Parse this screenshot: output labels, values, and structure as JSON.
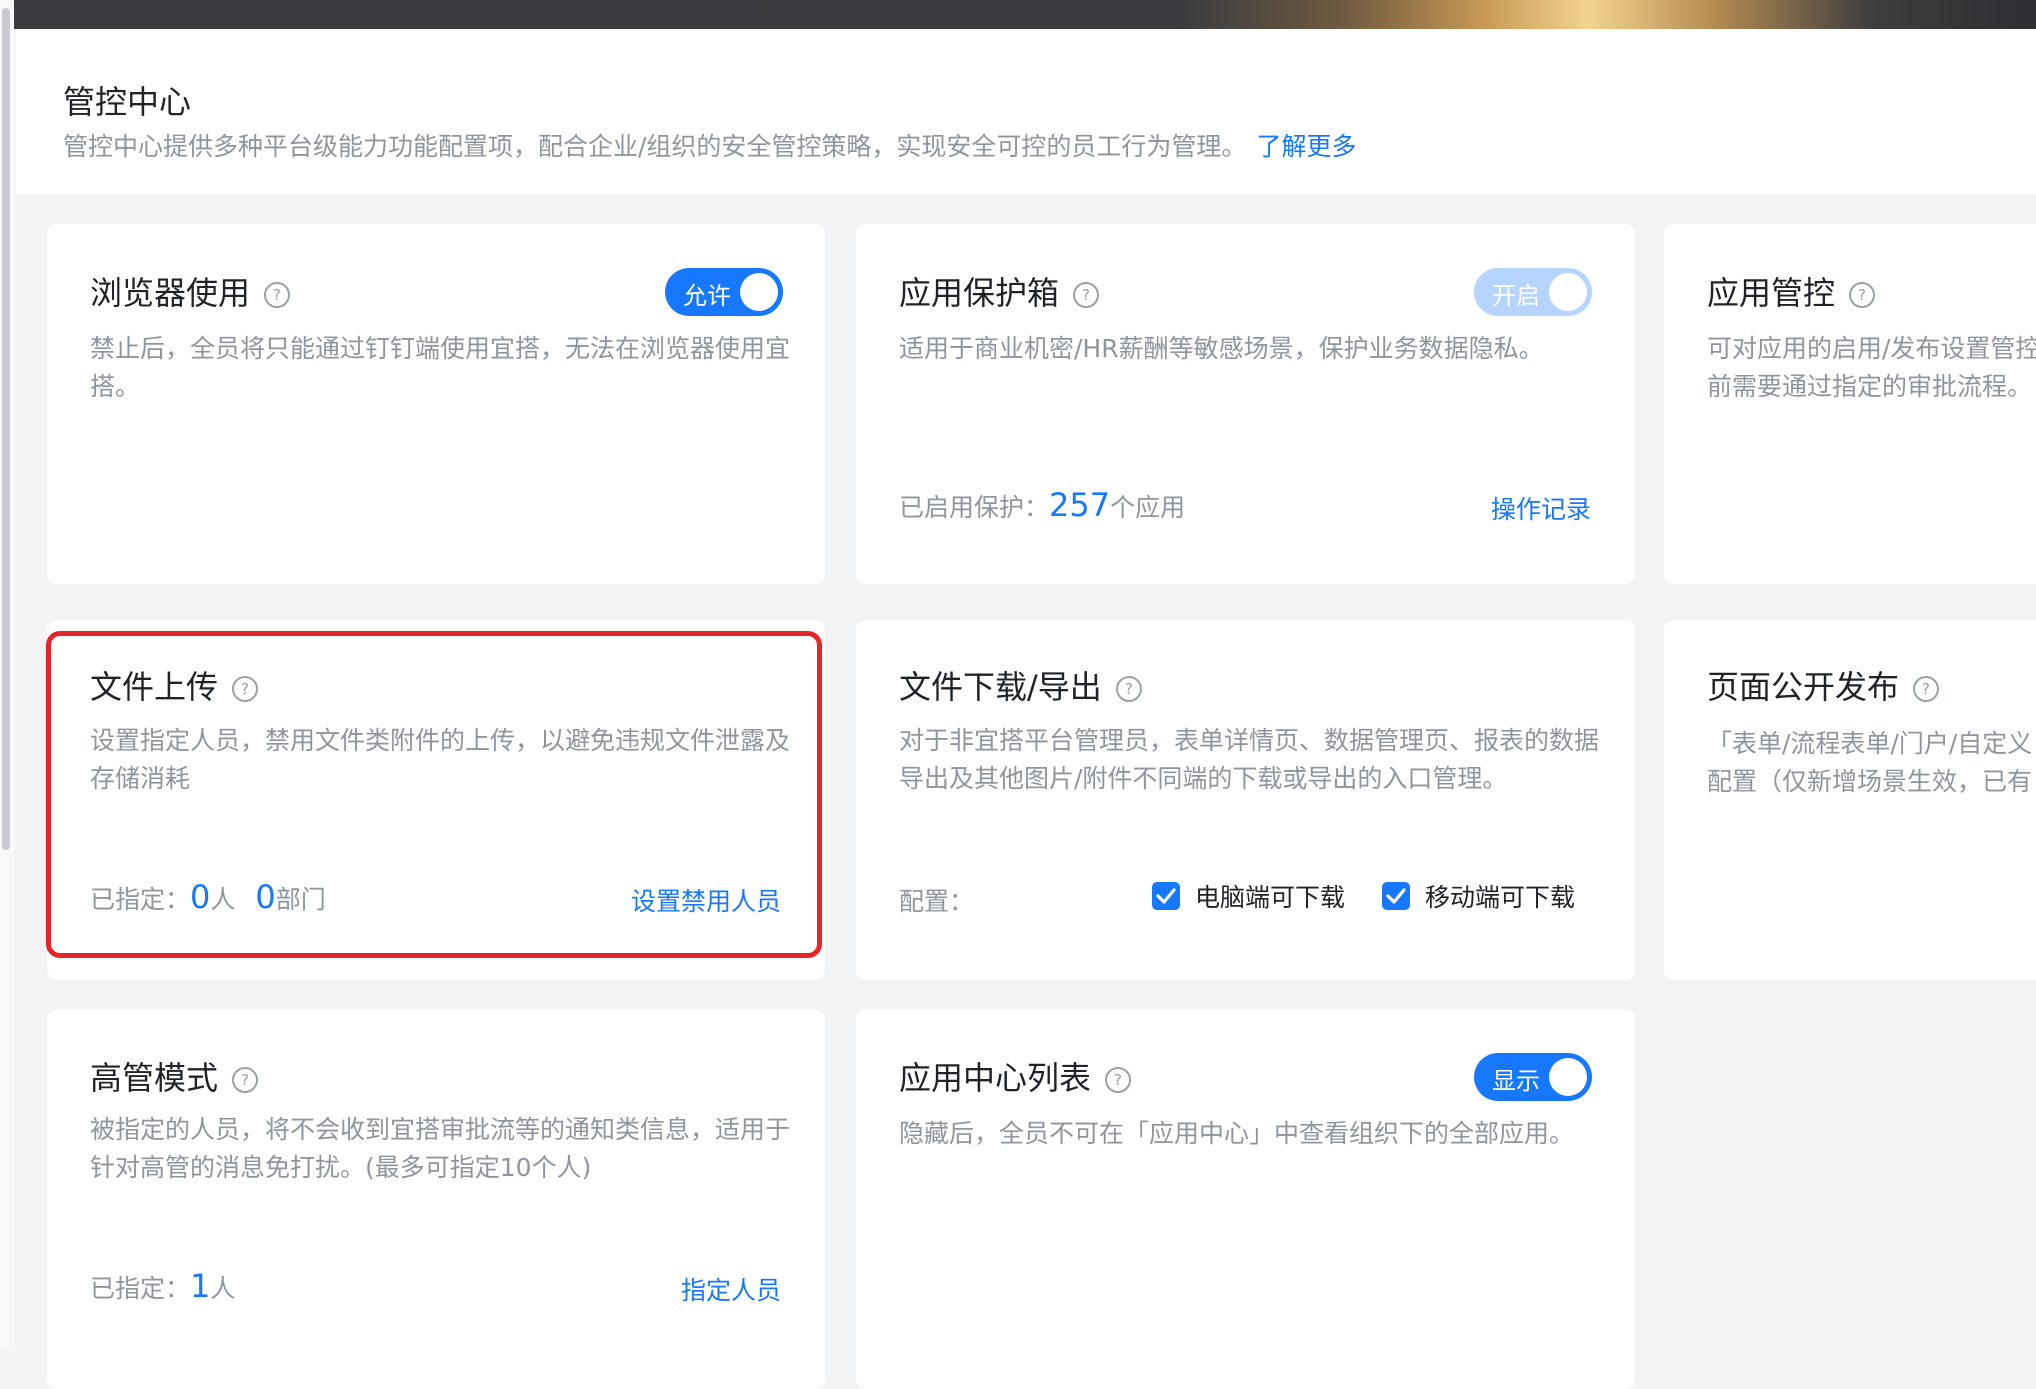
{
  "header": {
    "title": "管控中心",
    "description": "管控中心提供多种平台级能力功能配置项，配合企业/组织的安全管控策略，实现安全可控的员工行为管理。",
    "learn_more": "了解更多"
  },
  "help_glyph": "?",
  "cards": {
    "browser": {
      "title": "浏览器使用",
      "toggle_label": "允许",
      "description": "禁止后，全员将只能通过钉钉端使用宜搭，无法在浏览器使用宜搭。"
    },
    "protect_box": {
      "title": "应用保护箱",
      "toggle_label": "开启",
      "description": "适用于商业机密/HR薪酬等敏感场景，保护业务数据隐私。",
      "enabled_label": "已启用保护：",
      "enabled_count": "257",
      "enabled_unit": "个应用",
      "link": "操作记录"
    },
    "app_control": {
      "title": "应用管控",
      "description_line1": "可对应用的启用/发布设置管控",
      "description_line2": "前需要通过指定的审批流程。"
    },
    "file_upload": {
      "title": "文件上传",
      "description": "设置指定人员，禁用文件类附件的上传，以避免违规文件泄露及存储消耗",
      "assigned_label": "已指定：",
      "people_count": "0",
      "people_unit": "人",
      "dept_count": "0",
      "dept_unit": "部门",
      "link": "设置禁用人员"
    },
    "file_download": {
      "title": "文件下载/导出",
      "description": "对于非宜搭平台管理员，表单详情页、数据管理页、报表的数据导出及其他图片/附件不同端的下载或导出的入口管理。",
      "config_label": "配置：",
      "pc_label": "电脑端可下载",
      "mobile_label": "移动端可下载"
    },
    "page_publish": {
      "title": "页面公开发布",
      "description_line1": "「表单/流程表单/门户/自定义",
      "description_line2": "配置（仅新增场景生效，已有"
    },
    "executive": {
      "title": "高管模式",
      "description": "被指定的人员，将不会收到宜搭审批流等的通知类信息，适用于针对高管的消息免打扰。(最多可指定10个人)",
      "assigned_label": "已指定：",
      "people_count": "1",
      "people_unit": "人",
      "link": "指定人员"
    },
    "app_center": {
      "title": "应用中心列表",
      "toggle_label": "显示",
      "description": "隐藏后，全员不可在「应用中心」中查看组织下的全部应用。"
    }
  }
}
